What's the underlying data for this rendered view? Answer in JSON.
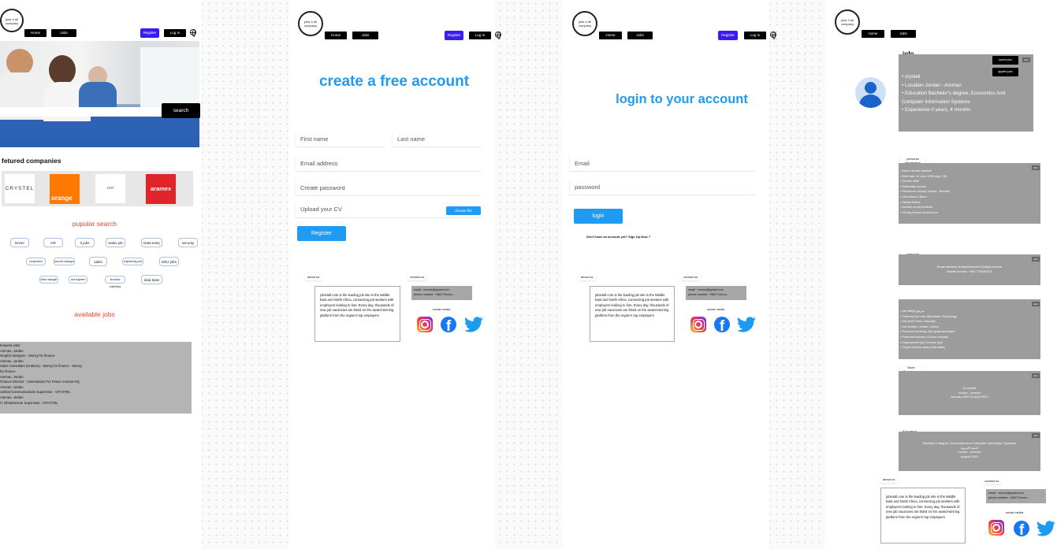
{
  "brand": {
    "logo_text": "jobs 4 all company"
  },
  "nav": {
    "home": "Home",
    "jobs": "Jobs",
    "register": "Register",
    "login": "Log In"
  },
  "home": {
    "search_label": "search",
    "featured_title": "fetured companies",
    "companies": [
      "CRYSTEL",
      "orange",
      "zain",
      "aramex"
    ],
    "popular_title": "pupular search",
    "popular_row1": [
      "Driver",
      "HR",
      "It jobs",
      "Sales job",
      "Data entry",
      "security"
    ],
    "popular_row2": [
      "receptionist",
      "account manager",
      "sales",
      "engineering jobs",
      "MOJ jobs"
    ],
    "popular_row3": [
      "office manager",
      "civil engineer",
      "technical marketing",
      "data base"
    ],
    "available_title": "available jobs",
    "jobs_lines": [
      "featured Jobs",
      "Amman, Jordan",
      "Graphic Designer - Money for finance",
      "Amman, Jordan",
      "Sales Consultant (Outdoor) - Money for finance - Money",
      "for finance",
      "Amman, Jordan",
      "Finance Director - Generations For Peace Amman-HQ",
      "Amman, Jordan",
      "Unified Communications Supervisor - CRYSTEL",
      "Amman, Jordan",
      "IT Infrastructure Supervisor - CRYSTEL"
    ]
  },
  "register": {
    "title": "create a free account",
    "first_name": "First name",
    "last_name": "Last name",
    "email": "Email address",
    "password": "Create password",
    "upload": "Upload your CV",
    "choose_file": "choose file",
    "button": "Register"
  },
  "login": {
    "title": "login to your account",
    "email": "Email",
    "password": "password",
    "button": "login",
    "signup_prompt": "Don't have an account yet? Sign Up Now ?"
  },
  "footer": {
    "about_label": "about us",
    "about_text": "jobs4all.com is the leading job site in the Middle East and North Africa, connecting job seekers with employers looking to hire. Every day, thousands of new job vacancies are listed on the award-winning platform from the region's top employers",
    "contact_label": "contact us",
    "contact_email": "email : xxxxxx@gmail.com",
    "contact_phone": "phone number: +96277xxxxx...",
    "social_label": "social media"
  },
  "profile": {
    "info_title": "info",
    "saved_jobs": "saved jobs",
    "applied_jobs": "applied jobs",
    "info_items": [
      "crystell",
      "Location Jordan - Amman",
      "Education Bachelor's degree, Economics And Computer Information Systems",
      "Experience 0 years, 4 months"
    ],
    "edit": "Edit",
    "personal_title": "personal information",
    "personal_items": [
      "Name ahmad alsweeh",
      "Birth date 15 June 1999 (Age: 26)",
      "Gender Male",
      "Nationality Jordan",
      "Residence country Jordan - Amman",
      "Visa status Citizen",
      "Marital Status",
      "Number of dependents",
      "Driving license issued from"
    ],
    "contact_title": "personal information",
    "contact_lines": [
      "Email address ahmadalsweeh123@gmail.com",
      "Mobile number +962 776000201"
    ],
    "preferred_title": "Preferred Job",
    "preferred_items": [
      "Job title(s) مبرمج",
      "Preferred job role Information Technology",
      "Job level Fresh Graduate",
      "Job location Jordan, Citizen",
      "Personal summary Add goals and plans",
      "Preferred industry Choose industry",
      "Employment type Choose type",
      "Target monthly salary Add salary"
    ],
    "work_title": "Work Experience",
    "work_lines": [
      "at crystell",
      "Jordan - amman",
      "January 2022 to April 2022"
    ],
    "education_title": "Education",
    "education_lines": [
      "Bachelor's degree, Economics And Computer Information Systems",
      "جامعة الزيتونة",
      "Jordan - Amman",
      "August 2021"
    ]
  }
}
